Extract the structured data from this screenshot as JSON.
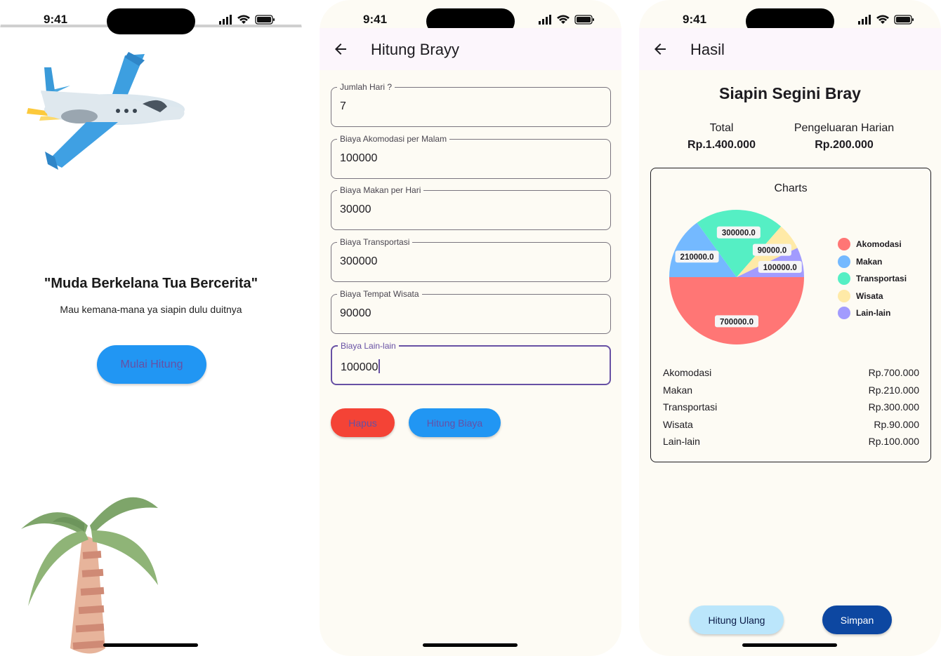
{
  "status_bar": {
    "time": "9:41"
  },
  "screen1": {
    "quote": "\"Muda Berkelana Tua Bercerita\"",
    "tagline": "Mau kemana-mana ya siapin dulu duitnya",
    "start_button": "Mulai Hitung"
  },
  "screen2": {
    "title": "Hitung Brayy",
    "fields": [
      {
        "label": "Jumlah Hari ?",
        "value": "7"
      },
      {
        "label": "Biaya Akomodasi per Malam",
        "value": "100000"
      },
      {
        "label": "Biaya Makan per Hari",
        "value": "30000"
      },
      {
        "label": "Biaya Transportasi",
        "value": "300000"
      },
      {
        "label": "Biaya Tempat Wisata",
        "value": "90000"
      },
      {
        "label": "Biaya Lain-lain",
        "value": "100000"
      }
    ],
    "delete_button": "Hapus",
    "calculate_button": "Hitung Biaya"
  },
  "screen3": {
    "title": "Hasil",
    "heading": "Siapin Segini Bray",
    "total_label": "Total",
    "total_value": "Rp.1.400.000",
    "daily_label": "Pengeluaran Harian",
    "daily_value": "Rp.200.000",
    "breakdown": [
      {
        "name": "Akomodasi",
        "amount": "Rp.700.000"
      },
      {
        "name": "Makan",
        "amount": "Rp.210.000"
      },
      {
        "name": "Transportasi",
        "amount": "Rp.300.000"
      },
      {
        "name": "Wisata",
        "amount": "Rp.90.000"
      },
      {
        "name": "Lain-lain",
        "amount": "Rp.100.000"
      }
    ],
    "recalc_button": "Hitung Ulang",
    "save_button": "Simpan"
  },
  "chart_data": {
    "type": "pie",
    "title": "Charts",
    "slices": [
      {
        "name": "Akomodasi",
        "value": 700000,
        "label": "700000.0",
        "color": "#ff7675"
      },
      {
        "name": "Makan",
        "value": 210000,
        "label": "210000.0",
        "color": "#74b9ff"
      },
      {
        "name": "Transportasi",
        "value": 300000,
        "label": "300000.0",
        "color": "#55efc4"
      },
      {
        "name": "Wisata",
        "value": 90000,
        "label": "90000.0",
        "color": "#ffeaa7"
      },
      {
        "name": "Lain-lain",
        "value": 100000,
        "label": "100000.0",
        "color": "#a29bfe"
      }
    ],
    "legend_position": "right"
  },
  "colors": {
    "primary_purple": "#6750a4",
    "blue_button": "#2196f3",
    "red_button": "#f44336",
    "dark_blue": "#0d47a1",
    "light_blue": "#bbe6fb"
  },
  "icons": [
    "plane-illustration",
    "palm-tree-illustration",
    "back-arrow-icon",
    "signal-icon",
    "wifi-icon",
    "battery-icon"
  ]
}
